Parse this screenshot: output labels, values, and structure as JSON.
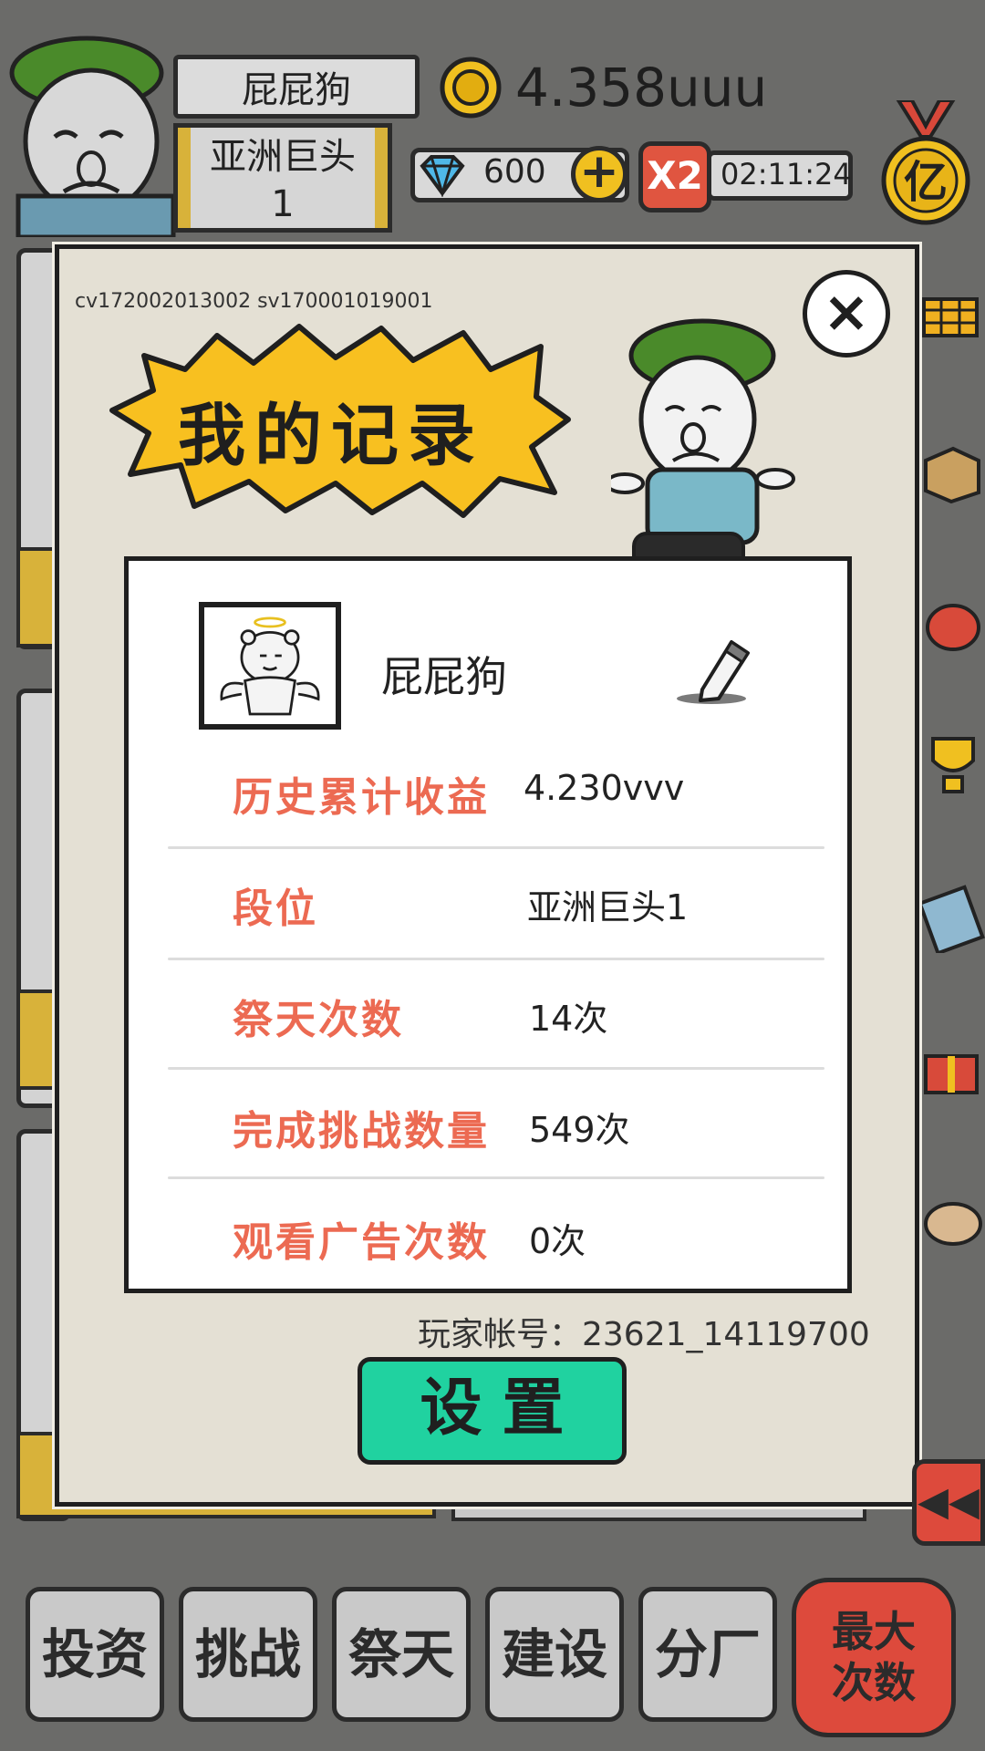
{
  "hud": {
    "player_name": "屁屁狗",
    "rank_line1": "亚洲巨头",
    "rank_line2": "1",
    "coins": "4.358uuu",
    "gems": "600",
    "plus": "+",
    "multiplier": "X2",
    "timer": "02:11:24",
    "medal_char": "亿"
  },
  "modal": {
    "version": "cv172002013002 sv170001019001",
    "title": "我的记录",
    "close": "×",
    "profile_name": "屁屁狗",
    "stats": [
      {
        "label": "历史累计收益",
        "value": "4.230vvv"
      },
      {
        "label": "段位",
        "value": "亚洲巨头1"
      },
      {
        "label": "祭天次数",
        "value": "14次"
      },
      {
        "label": "完成挑战数量",
        "value": "549次"
      },
      {
        "label": "观看广告次数",
        "value": "0次"
      }
    ],
    "account": "玩家帐号：23621_14119700",
    "settings_button": "设置"
  },
  "nav": {
    "items": [
      "投资",
      "挑战",
      "祭天",
      "建设",
      "分厂"
    ],
    "max_line1": "最大",
    "max_line2": "次数",
    "rewind": "◀◀"
  },
  "colors": {
    "accent_green": "#20d2a0",
    "stat_label": "#ec6a52",
    "title_burst": "#f8c020",
    "danger_red": "#dd4a3c"
  }
}
